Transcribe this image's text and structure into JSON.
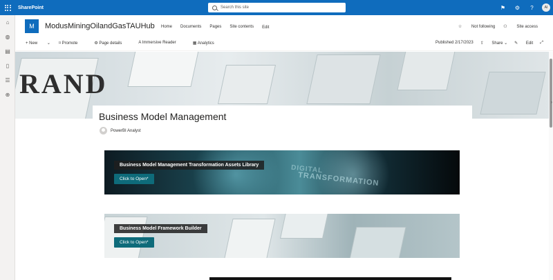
{
  "suitebar": {
    "brand": "SharePoint",
    "search_placeholder": "Search this site",
    "avatar_initials": "AI"
  },
  "site": {
    "logo_letter": "M",
    "title": "ModusMiningOilandGasTAUHub",
    "nav": [
      "Home",
      "Documents",
      "Pages",
      "Site contents",
      "Edit"
    ],
    "follow": "Not following",
    "access": "Site access"
  },
  "command_bar": {
    "new": "New",
    "promote": "Promote",
    "page_details": "Page details",
    "immersive_reader": "Immersive Reader",
    "analytics": "Analytics",
    "published": "Published 2/17/2023",
    "share": "Share",
    "edit": "Edit"
  },
  "hero": {
    "letters": "RAND"
  },
  "page": {
    "title": "Business Model Management",
    "author": "PowerBI Analyst"
  },
  "cards": [
    {
      "title": "Business Model Management Transformation Assets Library",
      "button": "Click to Open*",
      "overlay_top": "DIGITAL",
      "overlay_bottom": "TRANSFORMATION"
    },
    {
      "title": "Business Model Framework Builder",
      "button": "Click to Open*"
    }
  ]
}
